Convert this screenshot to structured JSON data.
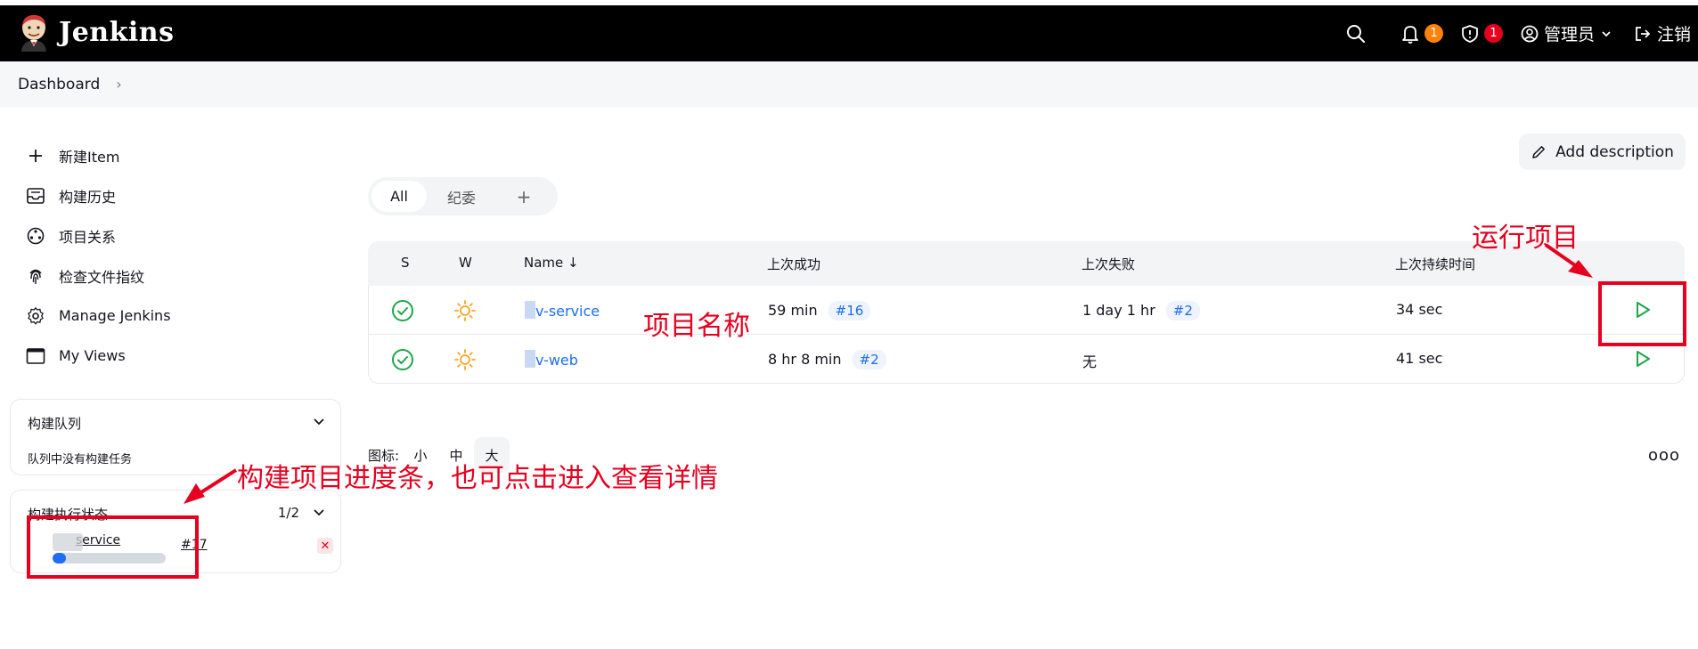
{
  "app": {
    "name": "Jenkins"
  },
  "header": {
    "notifications_count": "1",
    "security_count": "1",
    "user_label": "管理员",
    "logout_label": "注销"
  },
  "breadcrumb": {
    "items": [
      "Dashboard"
    ]
  },
  "sidebar": {
    "items": [
      {
        "label": "新建Item",
        "icon": "plus-icon"
      },
      {
        "label": "构建历史",
        "icon": "history-inbox-icon"
      },
      {
        "label": "项目关系",
        "icon": "relationship-icon"
      },
      {
        "label": "检查文件指纹",
        "icon": "fingerprint-icon"
      },
      {
        "label": "Manage Jenkins",
        "icon": "gear-icon"
      },
      {
        "label": "My Views",
        "icon": "window-icon"
      }
    ]
  },
  "build_queue": {
    "title": "构建队列",
    "empty_message": "队列中没有构建任务"
  },
  "executors": {
    "title": "构建执行状态",
    "count": "1/2",
    "job_name": "service",
    "build_number": "#17",
    "progress_percent": 12
  },
  "main": {
    "add_description_label": "Add description",
    "tabs": [
      {
        "label": "All"
      },
      {
        "label": "纪委"
      },
      {
        "label": "+"
      }
    ],
    "table": {
      "headers": {
        "s": "S",
        "w": "W",
        "name": "Name ↓",
        "last_success": "上次成功",
        "last_failure": "上次失败",
        "last_duration": "上次持续时间"
      },
      "rows": [
        {
          "name": "v-service",
          "last_success": "59 min",
          "last_success_build": "#16",
          "last_failure": "1 day 1 hr",
          "last_failure_build": "#2",
          "last_duration": "34 sec",
          "status": "success",
          "weather": "sunny"
        },
        {
          "name": "v-web",
          "last_success": "8 hr 8 min",
          "last_success_build": "#2",
          "last_failure": "无",
          "last_failure_build": "",
          "last_duration": "41 sec",
          "status": "success",
          "weather": "sunny"
        }
      ]
    },
    "icon_size": {
      "label": "图标:",
      "options": [
        "小",
        "中",
        "大"
      ],
      "selected": "大"
    },
    "more_label": "ooo"
  },
  "annotations": {
    "run_project": "运行项目",
    "project_name": "项目名称",
    "progress_note": "构建项目进度条，也可点击进入查看详情"
  },
  "colors": {
    "header_bg": "#000000",
    "link": "#1d6ef3",
    "success": "#1ea64b",
    "annotation": "#e6001f",
    "notify_badge": "#fe820a",
    "security_badge": "#e6001f"
  }
}
